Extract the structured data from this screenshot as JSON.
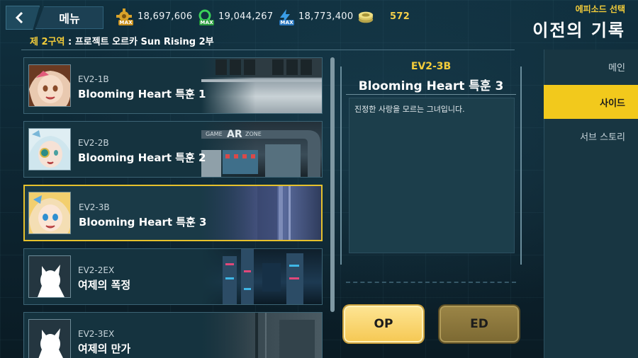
{
  "header": {
    "menu_label": "메뉴",
    "resources": [
      {
        "icon": "gear-gold-icon",
        "value": "18,697,606",
        "badge": "MAX"
      },
      {
        "icon": "gear-green-icon",
        "value": "19,044,267",
        "badge": "MAX"
      },
      {
        "icon": "bolt-blue-icon",
        "value": "18,773,400",
        "badge": "MAX"
      },
      {
        "icon": "coin-stack-icon",
        "value": "572"
      }
    ],
    "subtitle": "에피소드 선택",
    "title": "이전의 기록"
  },
  "area": {
    "zone": "제 2구역",
    "separator": " : ",
    "name": "프로젝트 오르카 Sun Rising 2부"
  },
  "stages": [
    {
      "code": "EV2-1B",
      "name": "Blooming Heart 특훈 1",
      "selected": false
    },
    {
      "code": "EV2-2B",
      "name": "Blooming Heart 특훈 2",
      "selected": false
    },
    {
      "code": "EV2-3B",
      "name": "Blooming Heart 특훈 3",
      "selected": true
    },
    {
      "code": "EV2-2EX",
      "name": "여제의 폭정",
      "selected": false
    },
    {
      "code": "EV2-3EX",
      "name": "여제의 만가",
      "selected": false
    }
  ],
  "detail": {
    "code": "EV2-3B",
    "name": "Blooming Heart 특훈 3",
    "description": "진정한 사랑을 모르는 그녀입니다."
  },
  "buttons": {
    "op": "OP",
    "ed": "ED"
  },
  "tabs": {
    "main": "메인",
    "side": "사이드",
    "sub": "서브 스토리"
  },
  "colors": {
    "accent": "#f2c91c",
    "highlight_text": "#f4cd3a",
    "panel": "#15333f"
  }
}
